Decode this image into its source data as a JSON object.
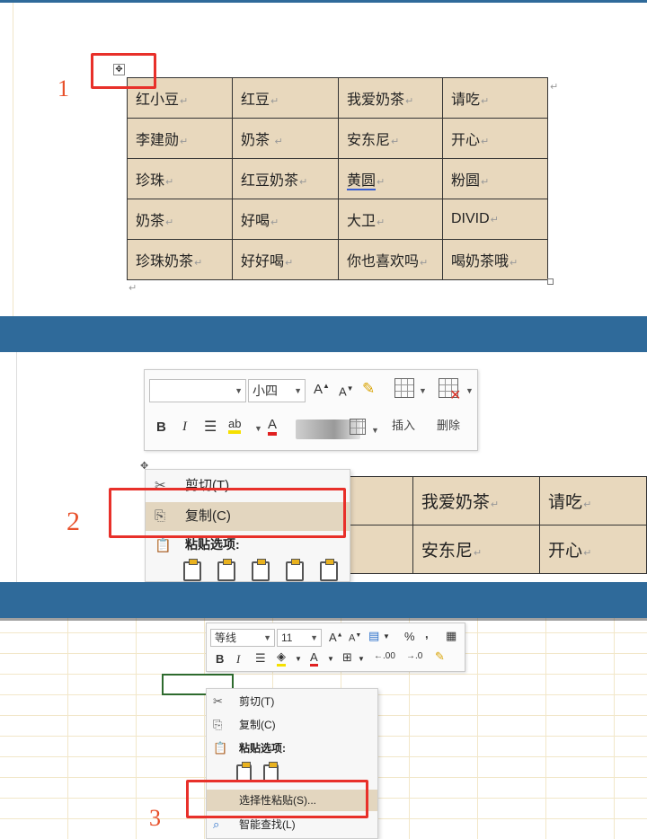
{
  "steps": {
    "one": "1",
    "two": "2",
    "three": "3"
  },
  "panel1": {
    "table": [
      [
        "红小豆",
        "红豆",
        "我爱奶茶",
        "请吃"
      ],
      [
        "李建勋",
        "奶茶 ",
        "安东尼",
        "开心"
      ],
      [
        "珍珠",
        "红豆奶茶",
        "黄圆",
        "粉圆"
      ],
      [
        "奶茶",
        "好喝",
        "大卫",
        "DIVID"
      ],
      [
        "珍珠奶茶",
        "好好喝",
        "你也喜欢吗",
        "喝奶茶哦"
      ]
    ],
    "mark": "↵",
    "move_handle_icon": "move-cross-icon"
  },
  "panel2": {
    "toolbar": {
      "font_name": "",
      "font_size": "小四",
      "grow_font": "A",
      "shrink_font": "A",
      "bold": "B",
      "italic": "I",
      "font_color": "A",
      "insert": "插入",
      "delete": "删除"
    },
    "menu": {
      "cut": "剪切(T)",
      "copy": "复制(C)",
      "paste_options": "粘贴选项:"
    },
    "table": [
      [
        "",
        "我爱奶茶",
        "请吃"
      ],
      [
        "",
        "安东尼",
        "开心"
      ]
    ],
    "highlight_color": "#e3d6bf"
  },
  "panel3": {
    "toolbar": {
      "font_name": "等线",
      "font_size": "11",
      "bold": "B",
      "italic": "I",
      "percent": "%",
      "comma": ",",
      "increase_decimal": ".00",
      "decrease_decimal": ".0"
    },
    "menu": {
      "cut": "剪切(T)",
      "copy": "复制(C)",
      "paste_options": "粘贴选项:",
      "paste_special": "选择性粘贴(S)...",
      "smart_lookup": "智能查找(L)"
    }
  },
  "colors": {
    "band": "#2f6a9a",
    "table_fill": "#e8d8bd",
    "annotation_red": "#e8302a"
  }
}
